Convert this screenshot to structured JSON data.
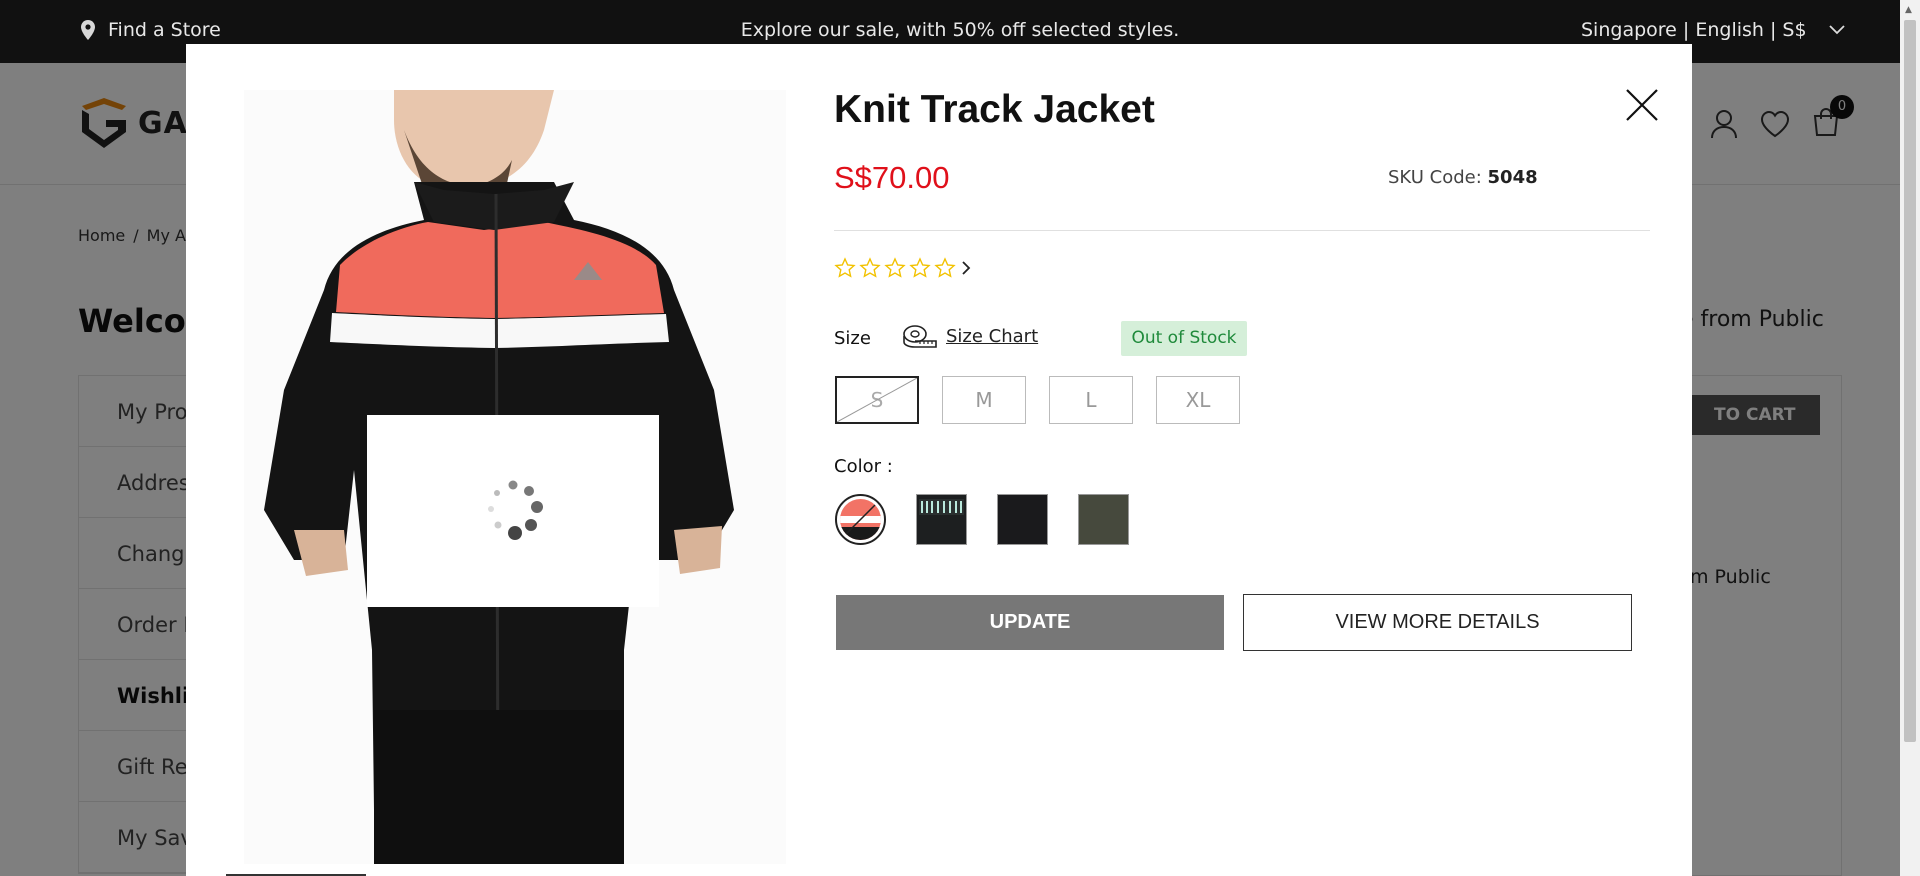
{
  "topbar": {
    "store_label": "Find a Store",
    "promo": "Explore our sale, with 50% off selected styles.",
    "locale": "Singapore | English | S$"
  },
  "header": {
    "brand_partial": "GAU",
    "cart_count": "0"
  },
  "background": {
    "breadcrumb": [
      "Home",
      "/",
      "My Ac"
    ],
    "welcome": "Welcom",
    "menu": [
      "My Prof",
      "Addres",
      "Chang",
      "Order H",
      "Wishlis",
      "Gift Reg",
      "My Sav"
    ],
    "active_menu_index": 4,
    "right_title": "e from Public",
    "add_to_cart": "TO CART",
    "right_text": "m Public"
  },
  "modal": {
    "title": "Knit Track Jacket",
    "price": "S$70.00",
    "sku_label": "SKU Code:",
    "sku_value": "5048",
    "rating_stars": 5,
    "rating_filled": 0,
    "size_label": "Size",
    "size_chart_label": "Size Chart",
    "stock_status": "Out of Stock",
    "sizes": [
      {
        "label": "S",
        "selected": true,
        "unavailable": true
      },
      {
        "label": "M",
        "selected": false,
        "unavailable": false
      },
      {
        "label": "L",
        "selected": false,
        "unavailable": false
      },
      {
        "label": "XL",
        "selected": false,
        "unavailable": false
      }
    ],
    "color_label": "Color :",
    "colors": [
      {
        "name": "coral-black",
        "hex": "#f27366",
        "selected": true
      },
      {
        "name": "black-print",
        "hex": "#1d1f20"
      },
      {
        "name": "black",
        "hex": "#1a1a1c"
      },
      {
        "name": "olive",
        "hex": "#46493d"
      }
    ],
    "update_label": "UPDATE",
    "details_label": "VIEW MORE DETAILS"
  },
  "colors": {
    "price": "#e0101a",
    "stock_bg": "#d5efd9",
    "stock_text": "#1f8a3b",
    "update_bg": "#777777",
    "star": "#f2c200"
  },
  "icons": [
    "location-pin-icon",
    "chevron-down-icon",
    "user-icon",
    "heart-icon",
    "shopping-bag-icon",
    "close-icon",
    "star-icon",
    "chevron-right-icon",
    "measuring-tape-icon",
    "loading-spinner-icon"
  ]
}
